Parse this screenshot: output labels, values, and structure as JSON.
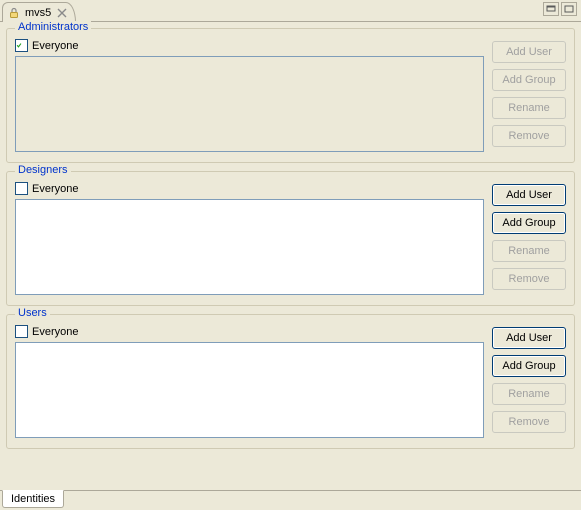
{
  "editor_tab": {
    "title": "mvs5"
  },
  "groups": {
    "administrators": {
      "legend": "Administrators",
      "everyone_label": "Everyone",
      "everyone_checked": true,
      "list_disabled": true,
      "buttons": {
        "add_user": "Add User",
        "add_group": "Add Group",
        "rename": "Rename",
        "remove": "Remove"
      },
      "buttons_enabled": {
        "add_user": false,
        "add_group": false,
        "rename": false,
        "remove": false
      }
    },
    "designers": {
      "legend": "Designers",
      "everyone_label": "Everyone",
      "everyone_checked": false,
      "list_disabled": false,
      "buttons": {
        "add_user": "Add User",
        "add_group": "Add Group",
        "rename": "Rename",
        "remove": "Remove"
      },
      "buttons_enabled": {
        "add_user": true,
        "add_group": true,
        "rename": false,
        "remove": false
      }
    },
    "users": {
      "legend": "Users",
      "everyone_label": "Everyone",
      "everyone_checked": false,
      "list_disabled": false,
      "buttons": {
        "add_user": "Add User",
        "add_group": "Add Group",
        "rename": "Rename",
        "remove": "Remove"
      },
      "buttons_enabled": {
        "add_user": true,
        "add_group": true,
        "rename": false,
        "remove": false
      }
    }
  },
  "bottom_tab": {
    "label": "Identities"
  }
}
